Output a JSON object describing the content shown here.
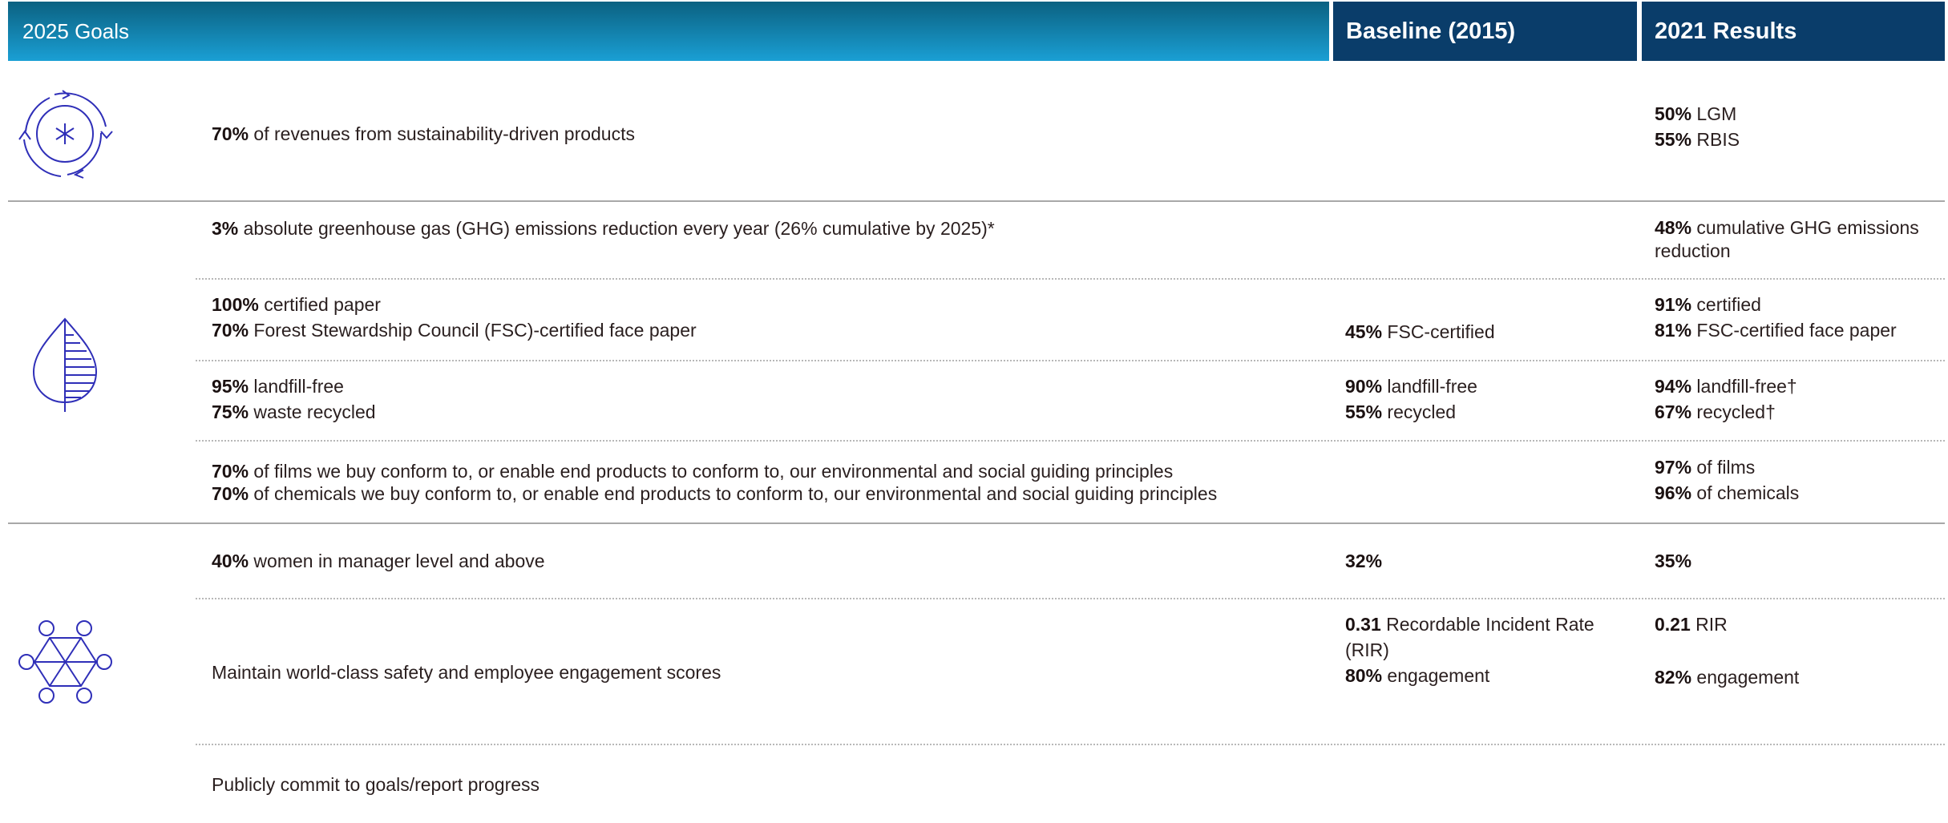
{
  "header": {
    "goals": "2025 Goals",
    "baseline": "Baseline (2015)",
    "results": "2021 Results"
  },
  "icons": [
    "recycle-cycle-icon",
    "leaf-icon",
    "people-network-icon"
  ],
  "rows": {
    "revenue": {
      "goal": {
        "v1": "70%",
        "t1": " of revenues from sustainability-driven products"
      },
      "result": {
        "v1": "50%",
        "t1": " LGM",
        "v2": "55%",
        "t2": " RBIS"
      }
    },
    "ghg": {
      "goal": {
        "v1": "3%",
        "t1": " absolute greenhouse gas (GHG) emissions reduction every year (26% cumulative by 2025)*"
      },
      "result": {
        "v1": "48%",
        "t1": " cumulative GHG emissions reduction"
      }
    },
    "paper": {
      "goal": {
        "v1": "100%",
        "t1": " certified paper",
        "v2": "70%",
        "t2": " Forest Stewardship Council (FSC)-certified face paper"
      },
      "baseline": {
        "v1": "45%",
        "t1": " FSC-certified"
      },
      "result": {
        "v1": "91%",
        "t1": " certified",
        "v2": "81%",
        "t2": " FSC-certified face paper"
      }
    },
    "waste": {
      "goal": {
        "v1": "95%",
        "t1": " landfill-free",
        "v2": "75%",
        "t2": " waste recycled"
      },
      "baseline": {
        "v1": "90%",
        "t1": " landfill-free",
        "v2": "55%",
        "t2": " recycled"
      },
      "result": {
        "v1": "94%",
        "t1": " landfill-free†",
        "v2": "67%",
        "t2": " recycled†"
      }
    },
    "films": {
      "goal": {
        "v1": "70%",
        "t1": " of films we buy conform to, or enable end products to conform to, our environmental and social guiding principles",
        "v2": "70%",
        "t2": " of chemicals we buy conform to, or enable end products to conform to, our environmental and social guiding principles"
      },
      "result": {
        "v1": "97%",
        "t1": " of films",
        "v2": "96%",
        "t2": " of chemicals"
      }
    },
    "women": {
      "goal": {
        "v1": "40%",
        "t1": " women in manager level and above"
      },
      "baseline": {
        "v1": "32%"
      },
      "result": {
        "v1": "35%"
      }
    },
    "safety": {
      "goal": {
        "t1": "Maintain world-class safety and employee engagement scores"
      },
      "baseline": {
        "v1": "0.31",
        "t1": " Recordable Incident Rate (RIR)",
        "v2": "80%",
        "t2": " engagement"
      },
      "result": {
        "v1": "0.21",
        "t1": " RIR",
        "v2": "82%",
        "t2": " engagement"
      }
    },
    "publish": {
      "goal": {
        "t1": "Publicly commit to goals/report progress"
      }
    }
  },
  "colors": {
    "header_gradient_top": "#0b6181",
    "header_gradient_bottom": "#1a9fd4",
    "header_dark": "#0a3d6a",
    "icon_stroke": "#2f2fb8"
  }
}
